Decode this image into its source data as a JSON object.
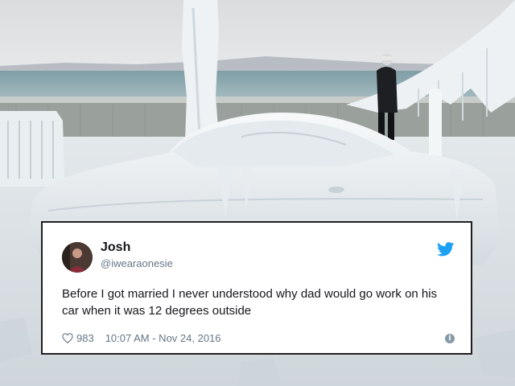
{
  "tweet": {
    "name": "Josh",
    "handle": "@iwearaonesie",
    "text": "Before I got married I never understood why dad would go work on his car when it was 12 degrees outside",
    "likes": "983",
    "timestamp": "10:07 AM - Nov 24, 2016"
  },
  "icons": {
    "brand": "twitter-bird-icon",
    "like": "heart-icon",
    "info": "info-icon"
  },
  "colors": {
    "twitter_blue": "#1da1f2",
    "text": "#14171a",
    "muted": "#657786"
  }
}
